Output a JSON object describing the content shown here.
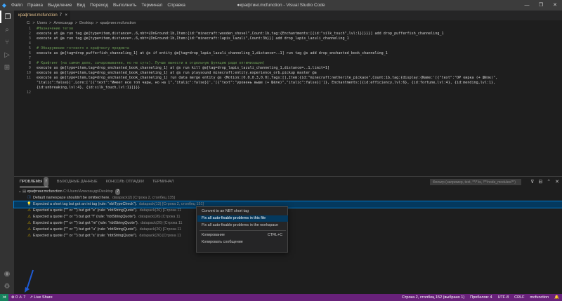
{
  "titlebar": {
    "menu": [
      "Файл",
      "Правка",
      "Выделение",
      "Вид",
      "Переход",
      "Выполнить",
      "Терминал",
      "Справка"
    ],
    "title": "●крафтинг.mcfunction - Visual Studio Code",
    "minimize": "—",
    "maximize": "❐",
    "close": "✕"
  },
  "tab": {
    "label": "крафтинг.mcfunction",
    "modified": "7",
    "close": "×"
  },
  "breadcrumb": [
    "C:",
    ">",
    "Users",
    ">",
    "Александр",
    ">",
    "Desktop",
    ">",
    "крафтинг.mcfunction"
  ],
  "editor": {
    "line_numbers": [
      "1",
      "2",
      "3",
      "4",
      "5",
      "6",
      "7",
      "8",
      "9",
      "10",
      "11",
      "",
      "",
      "12"
    ],
    "lines": [
      "#Назначение тегов",
      "execute at @a run tag @e[type=item,distance=..6,nbt={OnGround:1b,Item:{id:\"minecraft:wooden_shovel\",Count:1b,tag:{Enchantments:[{id:\"silk_touch\",lvl:1}]}}}] add drop_pufferfish_channeling_1",
      "execute at @a run tag @e[type=item,distance=..6,nbt={OnGround:1b,Item:{id:\"minecraft:lapis_lazuli\",Count:3b}}] add drop_lapis_lazuli_channeling_1",
      "",
      "# Обнаружение готового к крафтингу предмета",
      "execute as @e[tag=drop_pufferfish_channeling_1] at @s if entity @e[tag=drop_lapis_lazuli_channeling_1,distance=..1] run tag @s add drop_enchanted_book_channeling_1",
      "",
      "# Крафтинг (на самом деле, зачаровывание, но не суть). Лучше вынести в отдельную функцию ради оптимизации)",
      "execute as @e[type=item,tag=drop_enchanted_book_channeling_1] at @s run kill @e[tag=drop_lapis_lazuli_channeling_1,distance=..1,limit=1]",
      "execute as @e[type=item,tag=drop_enchanted_book_channeling_1] at @s run playsound minecraft:entity.experience_orb.pickup master @a",
      "execute as @e[type=item,tag=drop_enchanted_book_channeling_1] run data merge entity @s {Motion:[0.0,0.3,0.0],Tags:[],Item:{id:\"minecraft:netherite_pickaxe\",Count:1b,tag:{display:{Name:'[{\"text\":\"ОР кирка (+ Шёлк)\",",
      "\"italic\":false}]',Lore:['[{\"text\":\"Имеет все топ чары, но на 1\",\"italic\":false}]','[{\"text\":\"уровень выше (+ Шёлк)\",\"italic\":false}]']}, Enchantments:[{id:efficiency,lvl:6}, {id:fortune,lvl:4}, {id:mending,lvl:1},",
      "{id:unbreaking,lvl:4}, {id:silk_touch,lvl:1}]}}}",
      ""
    ]
  },
  "panel": {
    "tabs": [
      "ПРОБЛЕМЫ",
      "ВЫХОДНЫЕ ДАННЫЕ",
      "КОНСОЛЬ ОТЛАДКИ",
      "ТЕРМИНАЛ"
    ],
    "problems_count": "7",
    "filter_placeholder": "Фильтр (например, text, **/*.ts, !**/node_modules/**)",
    "file": {
      "name": "крафтинг.mcfunction",
      "path": "C:\\Users\\Александр\\Desktop",
      "count": "7"
    },
    "problems": [
      {
        "msg": "Default namespace shouldn't be omitted here.",
        "src": "datapack(2) [Строка 2, столбец 135]",
        "severity": "info"
      },
      {
        "msg": "Expected a short tag but got an int tag (rule: \"nbtTypeCheck\").",
        "src": "datapack(13) [Строка 2, столбец 151]",
        "severity": "warning"
      },
      {
        "msg": "Expected a quote (\"'\" or '\"') but got \"e\" (rule: \"nbtStringQuote\").",
        "src": "datapack(26) [Строка 11",
        "severity": "warning"
      },
      {
        "msg": "Expected a quote (\"'\" or '\"') but got \"f\" (rule: \"nbtStringQuote\").",
        "src": "datapack(26) [Строка 11",
        "severity": "warning"
      },
      {
        "msg": "Expected a quote (\"'\" or '\"') but got \"m\" (rule: \"nbtStringQuote\").",
        "src": "datapack(26) [Строка 11",
        "severity": "warning"
      },
      {
        "msg": "Expected a quote (\"'\" or '\"') but got \"u\" (rule: \"nbtStringQuote\").",
        "src": "datapack(26) [Строка 11",
        "severity": "warning"
      },
      {
        "msg": "Expected a quote (\"'\" or '\"') but got \"s\" (rule: \"nbtStringQuote\").",
        "src": "datapack(26) [Строка 11",
        "severity": "warning"
      }
    ]
  },
  "context_menu": {
    "items": [
      {
        "label": "Convert to an NBT short tag",
        "shortcut": ""
      },
      {
        "label": "Fix all auto-fixable problems in this file",
        "shortcut": ""
      },
      {
        "label": "Fix all auto-fixable problems in the workspace",
        "shortcut": ""
      },
      {
        "label": "Копирование",
        "shortcut": "CTRL+C"
      },
      {
        "label": "Копировать сообщение",
        "shortcut": ""
      }
    ]
  },
  "statusbar": {
    "errors": "0",
    "warnings": "7",
    "live_share": "Live Share",
    "position": "Строка 2, столбец 152 (выбрано 1)",
    "spaces": "Пробелов: 4",
    "encoding": "UTF-8",
    "eol": "CRLF",
    "language": "mcfunction"
  },
  "colors": {
    "statusbar": "#68217a",
    "selection": "#04395e",
    "arrow": "#1e5bd6"
  }
}
